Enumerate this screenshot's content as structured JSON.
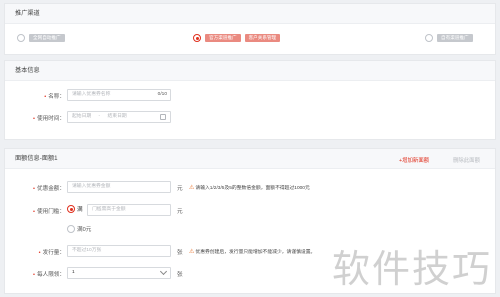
{
  "channel": {
    "title": "推广渠道",
    "options": [
      {
        "tags": [
          "全网自动推广"
        ],
        "selected": false
      },
      {
        "tags": [
          "官方渠道推广",
          "客户关系管理"
        ],
        "selected": true
      },
      {
        "tags": [
          "自有渠道推广"
        ],
        "selected": false
      }
    ]
  },
  "basic": {
    "title": "基本信息",
    "name_label": "名称：",
    "name_placeholder": "请输入优惠券名称",
    "name_counter": "0/10",
    "time_label": "使用时间：",
    "time_start": "起始日期",
    "time_sep": "-",
    "time_end": "结束日期"
  },
  "denom": {
    "title": "面额信息-面额1",
    "add_link": "+增加新面额",
    "delete_link": "删除此面额",
    "amount_label": "优惠金额：",
    "amount_placeholder": "请输入优惠券金额",
    "amount_unit": "元",
    "amount_hint": "请输入1/2/3/5及5的整数倍金额，面额不得超过1000元",
    "threshold_label": "使用门槛：",
    "threshold_opt1": "满",
    "threshold_placeholder": "门槛需高于金额",
    "threshold_unit": "元",
    "threshold_opt2": "满0元",
    "issue_label": "发行量：",
    "issue_placeholder": "不超过10万张",
    "issue_unit": "张",
    "issue_hint": "优惠券创建后，发行量只能增加不能减少，请谨慎设置。",
    "limit_label": "每人限领：",
    "limit_value": "1",
    "limit_unit": "张"
  },
  "watermark": "软件技巧",
  "colors": {
    "accent": "#e0301e",
    "tag_selected": "#ea8a80",
    "tag_default": "#c5c8cd",
    "warn": "#e8732c"
  }
}
